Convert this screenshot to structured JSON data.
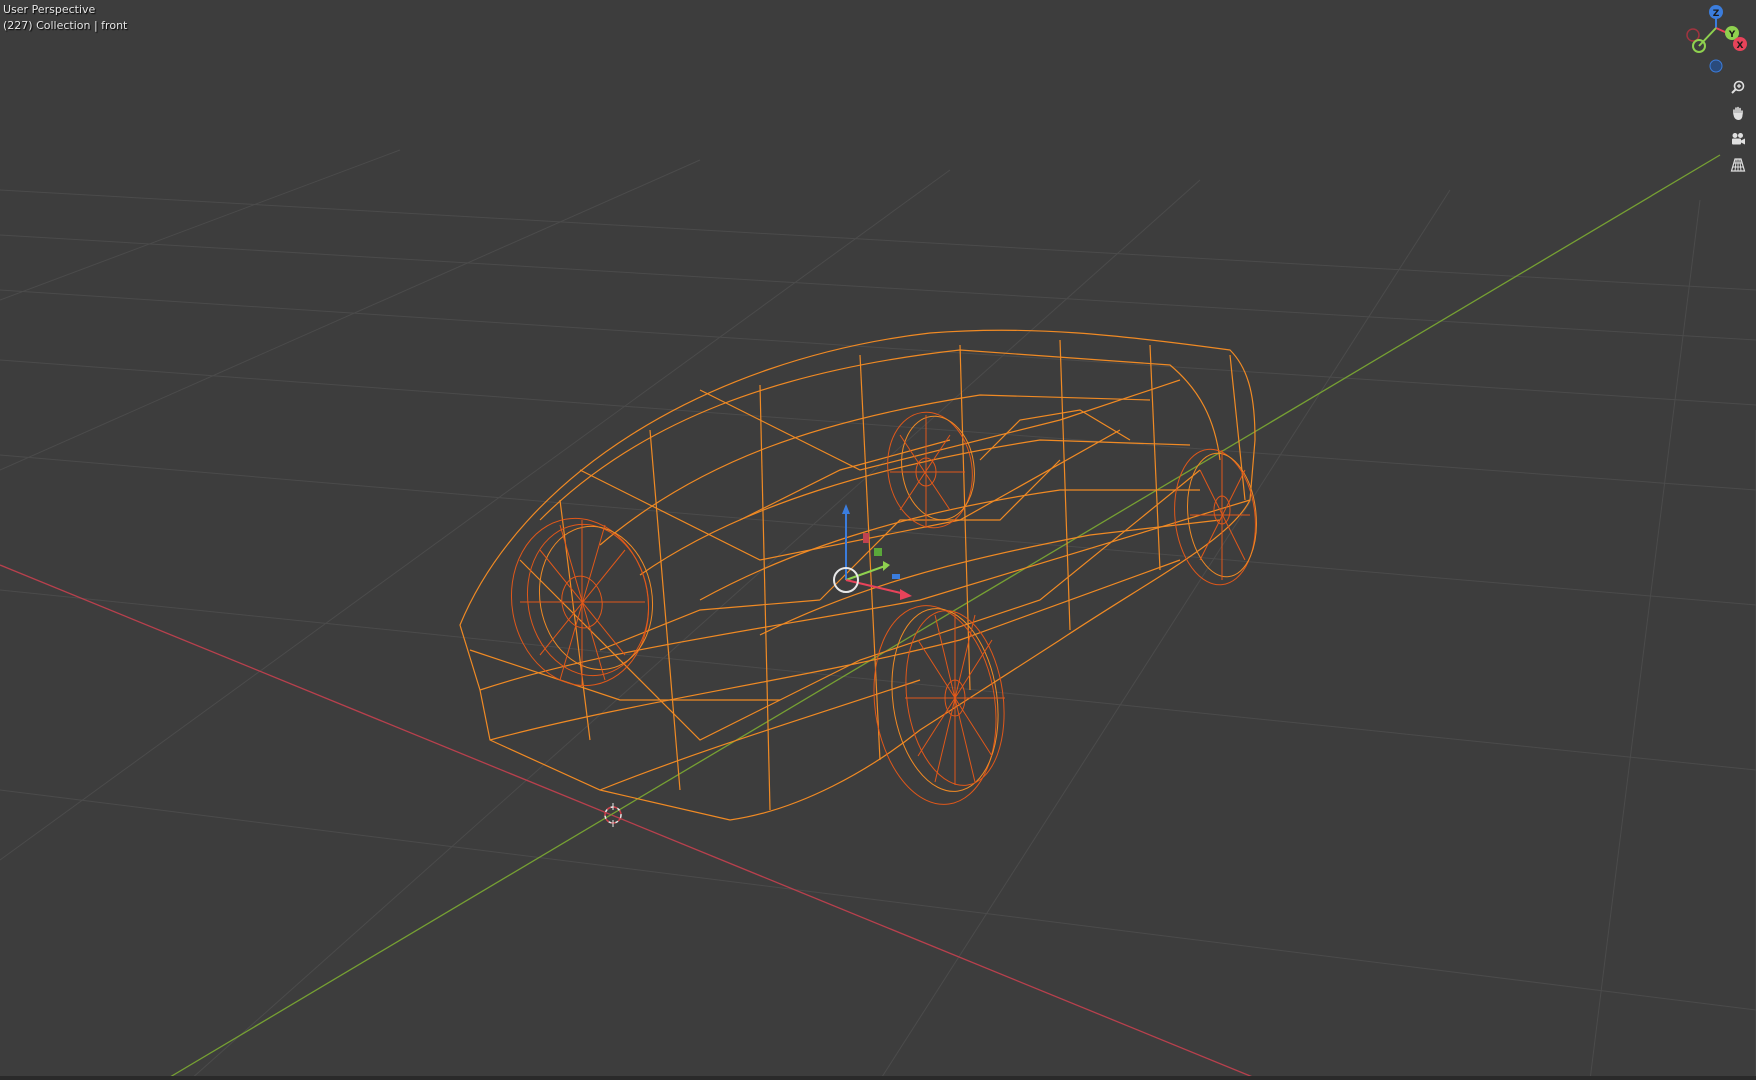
{
  "viewport": {
    "view_name": "User Perspective",
    "collection_info": "(227) Collection | front"
  },
  "gizmo": {
    "axes": [
      {
        "label": "Z",
        "color": "#3b7ddd"
      },
      {
        "label": "Y",
        "color": "#8fd14f"
      },
      {
        "label": "X",
        "color": "#e8435a"
      }
    ]
  },
  "nav_controls": [
    {
      "name": "zoom-icon"
    },
    {
      "name": "pan-hand-icon"
    },
    {
      "name": "camera-icon"
    },
    {
      "name": "grid-perspective-icon"
    }
  ],
  "colors": {
    "background": "#3d3d3d",
    "grid": "#4a4a4a",
    "x_axis": "#c0424f",
    "y_axis": "#7ea338",
    "wire_body": "#f08a24",
    "wire_wheel": "#e0581a",
    "origin": "#e8e8e8"
  }
}
